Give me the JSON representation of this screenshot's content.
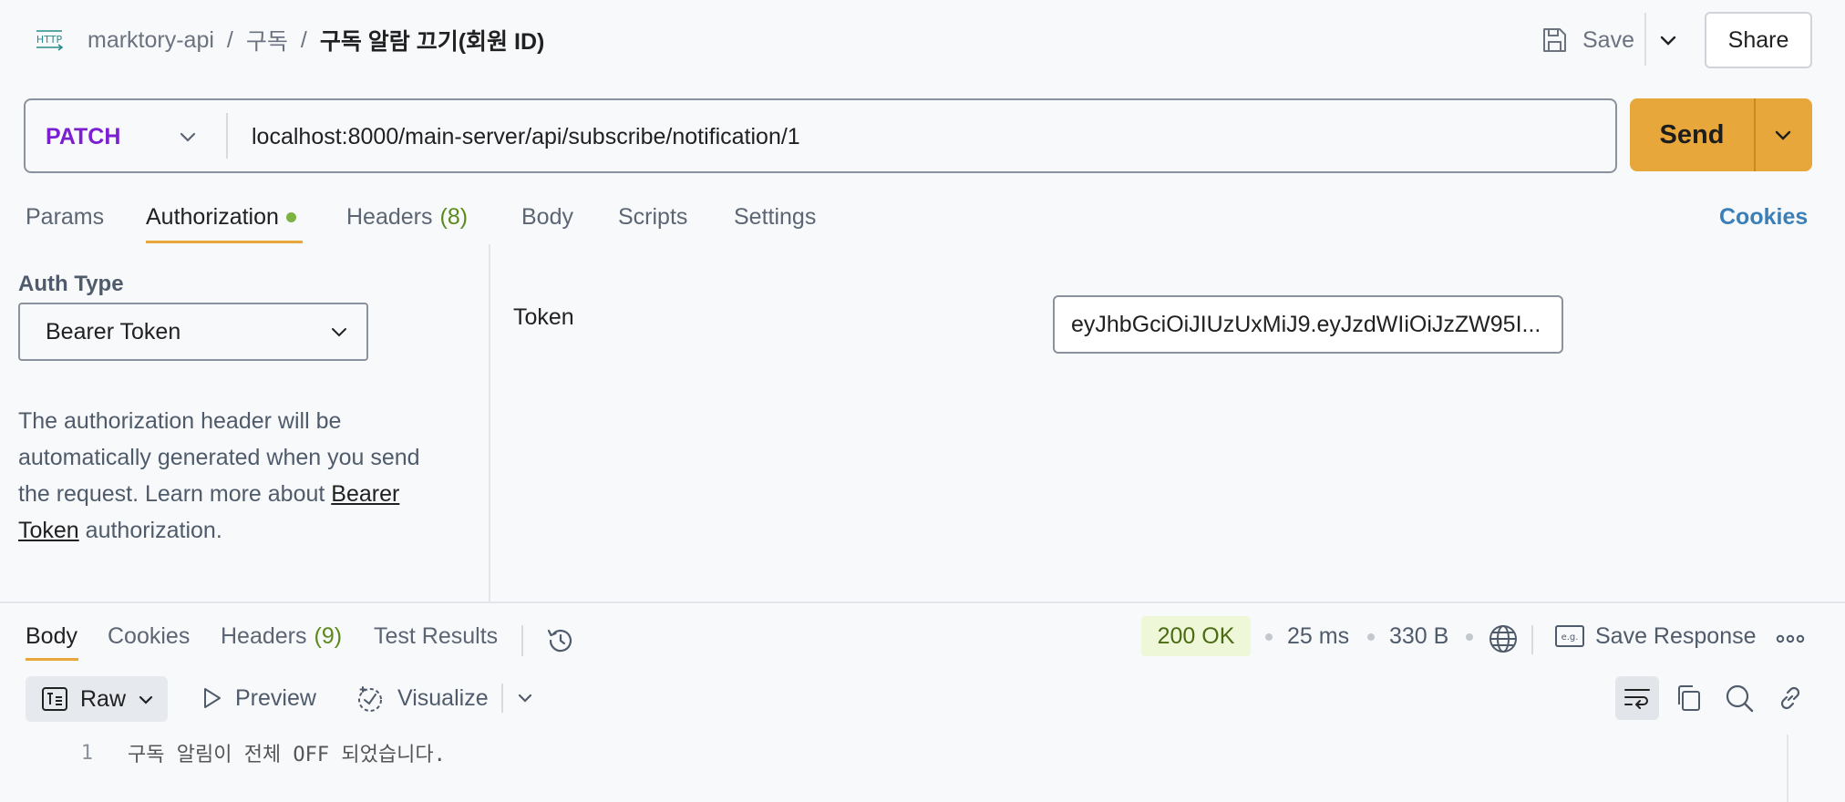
{
  "header": {
    "breadcrumb": [
      "marktory-api",
      "구독",
      "구독 알람 끄기(회원 ID)"
    ],
    "save_label": "Save",
    "share_label": "Share"
  },
  "request": {
    "method": "PATCH",
    "method_color": "#7b1fd1",
    "url": "localhost:8000/main-server/api/subscribe/notification/1",
    "send_label": "Send",
    "send_color": "#e8a73b"
  },
  "request_tabs": [
    {
      "label": "Params"
    },
    {
      "label": "Authorization",
      "indicator": "green-dot",
      "active": true
    },
    {
      "label": "Headers",
      "count": "(8)"
    },
    {
      "label": "Body"
    },
    {
      "label": "Scripts"
    },
    {
      "label": "Settings"
    }
  ],
  "cookies_link": "Cookies",
  "auth": {
    "type_label": "Auth Type",
    "type_value": "Bearer Token",
    "description_prefix": "The authorization header will be automatically generated when you send the request. Learn more about ",
    "description_link": "Bearer Token",
    "description_suffix": " authorization.",
    "token_label": "Token",
    "token_value": "eyJhbGciOiJIUzUxMiJ9.eyJzdWIiOiJzZW95I..."
  },
  "response": {
    "tabs": [
      {
        "label": "Body",
        "active": true
      },
      {
        "label": "Cookies"
      },
      {
        "label": "Headers",
        "count": "(9)"
      },
      {
        "label": "Test Results"
      }
    ],
    "status": "200 OK",
    "time": "25 ms",
    "size": "330 B",
    "save_response_label": "Save Response",
    "view_mode": "Raw",
    "preview_label": "Preview",
    "visualize_label": "Visualize",
    "lines": [
      {
        "number": "1",
        "text": "구독 알림이 전체 OFF 되었습니다."
      }
    ]
  },
  "icons": [
    "http-icon",
    "save-icon",
    "chevron-down-icon",
    "history-icon",
    "globe-icon",
    "example-icon",
    "more-icon",
    "raw-format-icon",
    "play-icon",
    "visualize-icon",
    "wrap-icon",
    "copy-icon",
    "search-icon",
    "link-icon"
  ]
}
